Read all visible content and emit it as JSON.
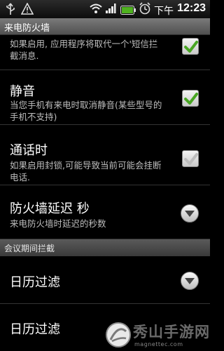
{
  "status_bar": {
    "period": "下午",
    "time": "12:23",
    "icons": [
      "usb-icon",
      "warning-icon",
      "wifi-icon",
      "signal-icon",
      "battery-icon",
      "alarm-icon"
    ]
  },
  "title_bar": {
    "title": "来电防火墙"
  },
  "settings": [
    {
      "title": "",
      "description_line1": "如果启用, 应用程序将取代一个'短信拦",
      "description_line2": "截消息.",
      "control": "checkbox",
      "checked": true
    },
    {
      "title": "静音",
      "description_line1": "当您手机有来电时取消静音(某些型号的",
      "description_line2": "手机不支持)",
      "control": "checkbox",
      "checked": true
    },
    {
      "title": "通话时",
      "description_line1": "如果启用封锁,可能导致当前可能会挂断",
      "description_line2": "电话.",
      "control": "checkbox",
      "checked": false
    },
    {
      "title": "防火墙延迟 秒",
      "description_line1": "来电防火墙时延迟的秒数",
      "description_line2": "",
      "control": "dropdown"
    }
  ],
  "section": {
    "label": "会议期间拦截"
  },
  "section_items": [
    {
      "title": "日历过滤",
      "control": "dropdown"
    },
    {
      "title": "日历过滤",
      "control": "dropdown"
    }
  ],
  "watermark": {
    "text": "秀山手游网",
    "url": "magnettec.com"
  },
  "colors": {
    "check_green": "#49a623",
    "check_grey": "#bdbdbd",
    "background": "#000000"
  }
}
